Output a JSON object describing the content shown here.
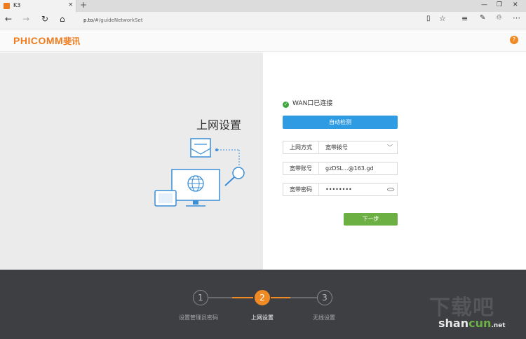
{
  "browser": {
    "tab_title": "K3",
    "tab_close": "×",
    "new_tab": "+",
    "url_host": "p.to",
    "url_path": "/#/guideNetworkSet",
    "win_minimize": "—",
    "win_restore": "❐",
    "win_close": "✕"
  },
  "header": {
    "brand": "PHICOMM",
    "brand_cn": "斐讯",
    "help": "?"
  },
  "left": {
    "page_title": "上网设置"
  },
  "form": {
    "wan_status": "WAN口已连接",
    "auto_detect": "自动检测",
    "mode_label": "上网方式",
    "mode_value": "宽带拨号",
    "account_label": "宽带账号",
    "account_value": "gzDSL...@163.gd",
    "password_label": "宽带密码",
    "password_value": "••••••••",
    "next_button": "下一步"
  },
  "steps": [
    {
      "num": "1",
      "label": "设置管理员密码",
      "active": false
    },
    {
      "num": "2",
      "label": "上网设置",
      "active": true
    },
    {
      "num": "3",
      "label": "无线设置",
      "active": false
    }
  ],
  "watermark": {
    "top": "下载吧",
    "bottom_a": "shan",
    "bottom_b": "cun",
    "bottom_c": ".net"
  },
  "colors": {
    "brand_orange": "#f07b1c",
    "detect_blue": "#2f9be3",
    "next_green": "#6cb043",
    "footer_bg": "#3e3f43"
  }
}
